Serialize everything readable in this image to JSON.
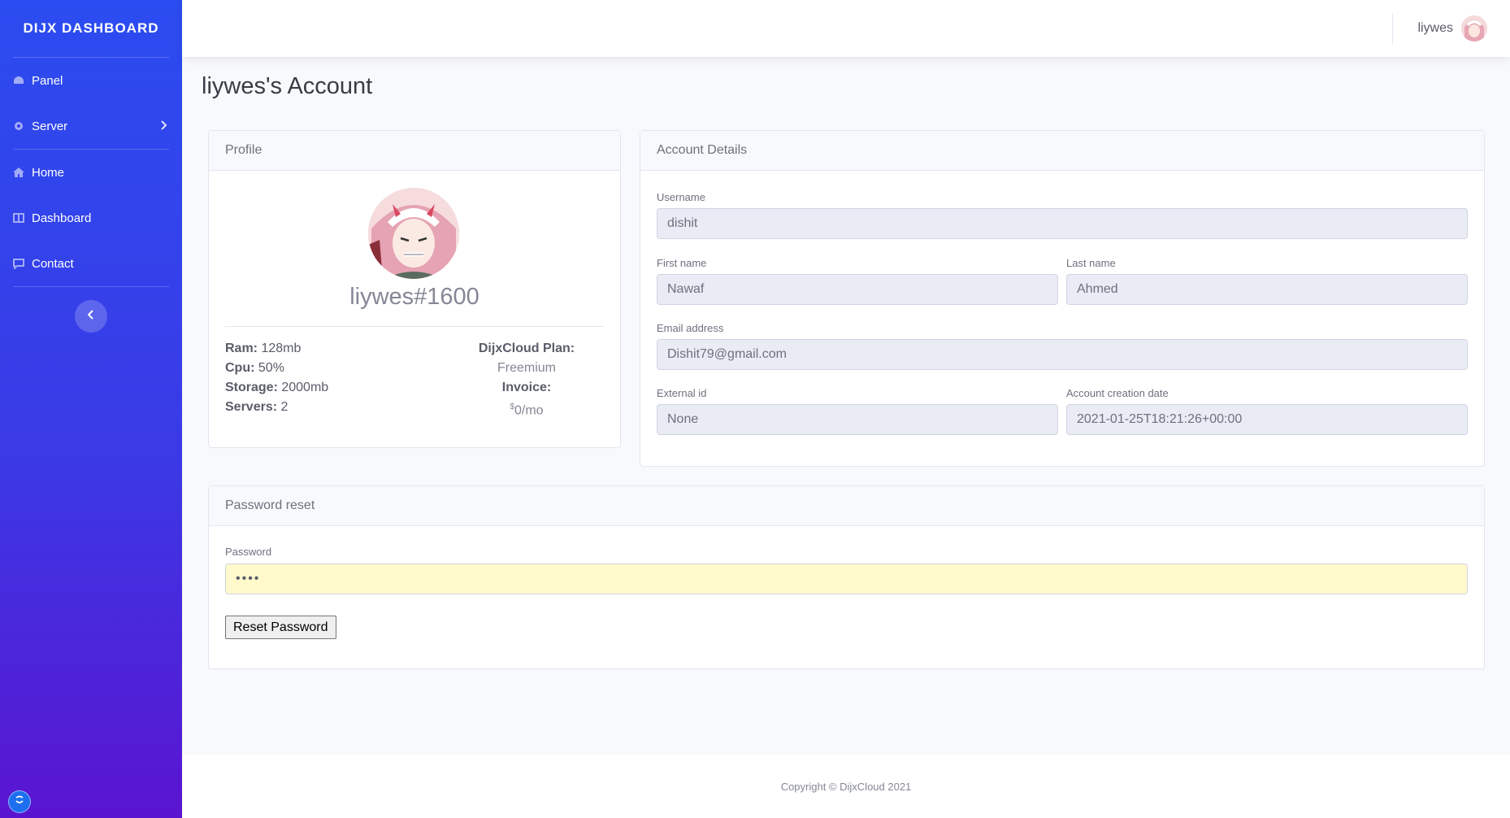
{
  "brand": {
    "title": "DIJX DASHBOARD"
  },
  "sidebar": {
    "items": [
      {
        "label": "Panel",
        "icon": "tachometer-icon"
      },
      {
        "label": "Server",
        "icon": "cog-icon",
        "has_submenu": true
      },
      {
        "label": "Home",
        "icon": "home-icon"
      },
      {
        "label": "Dashboard",
        "icon": "table-icon"
      },
      {
        "label": "Contact",
        "icon": "comment-icon"
      }
    ],
    "toggle_icon": "chevron-left-icon"
  },
  "topbar": {
    "user_name": "liywes"
  },
  "page": {
    "title": "liywes's Account"
  },
  "profile": {
    "header": "Profile",
    "handle": "liywes#1600",
    "stats": [
      {
        "label": "Ram:",
        "value": "128mb"
      },
      {
        "label": "Cpu:",
        "value": "50%"
      },
      {
        "label": "Storage:",
        "value": "2000mb"
      },
      {
        "label": "Servers:",
        "value": "2"
      }
    ],
    "plan_label": "DijxCloud Plan:",
    "plan_value": "Freemium",
    "invoice_label": "Invoice:",
    "invoice_currency": "$",
    "invoice_value": "0/mo"
  },
  "account": {
    "header": "Account Details",
    "username_label": "Username",
    "username": "dishit",
    "first_name_label": "First name",
    "first_name": "Nawaf",
    "last_name_label": "Last name",
    "last_name": "Ahmed",
    "email_label": "Email address",
    "email": "Dishit79@gmail.com",
    "external_id_label": "External id",
    "external_id": "None",
    "creation_date_label": "Account creation date",
    "creation_date": "2021-01-25T18:21:26+00:00"
  },
  "password": {
    "header": "Password reset",
    "label": "Password",
    "value": "••••",
    "button_label": "Reset Password"
  },
  "footer": {
    "text": "Copyright © DijxCloud 2021"
  },
  "colors": {
    "sidebar_top": "#2b4cf0",
    "sidebar_bottom": "#5a14d0",
    "password_bg": "#fff9cc"
  }
}
